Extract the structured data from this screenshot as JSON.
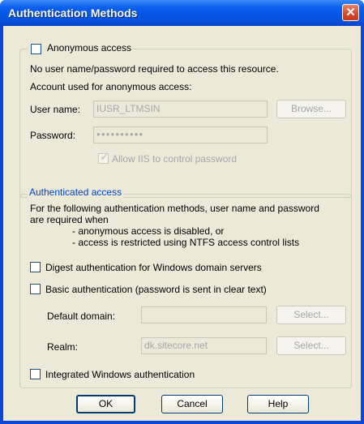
{
  "window": {
    "title": "Authentication Methods",
    "close_glyph": "✕"
  },
  "anonymous": {
    "checkbox_label": "Anonymous access",
    "description": "No user name/password required to access this resource.",
    "account_heading": "Account used for anonymous access:",
    "username_label": "User name:",
    "username_value": "IUSR_LTMSIN",
    "browse_label": "Browse...",
    "password_label": "Password:",
    "password_value": "●●●●●●●●●●",
    "allow_iis_label": "Allow IIS to control password"
  },
  "authenticated": {
    "legend": "Authenticated access",
    "description_line1": "For the following authentication methods, user name and password",
    "description_line2": "are required when",
    "bullet1": "- anonymous access is disabled, or",
    "bullet2": "- access is restricted using NTFS access control lists",
    "digest_label": "Digest authentication for Windows domain servers",
    "basic_label": "Basic authentication (password is sent in clear text)",
    "default_domain_label": "Default domain:",
    "default_domain_value": "",
    "select_label": "Select...",
    "realm_label": "Realm:",
    "realm_value": "dk.sitecore.net",
    "integrated_label": "Integrated Windows authentication"
  },
  "buttons": {
    "ok": "OK",
    "cancel": "Cancel",
    "help": "Help"
  }
}
